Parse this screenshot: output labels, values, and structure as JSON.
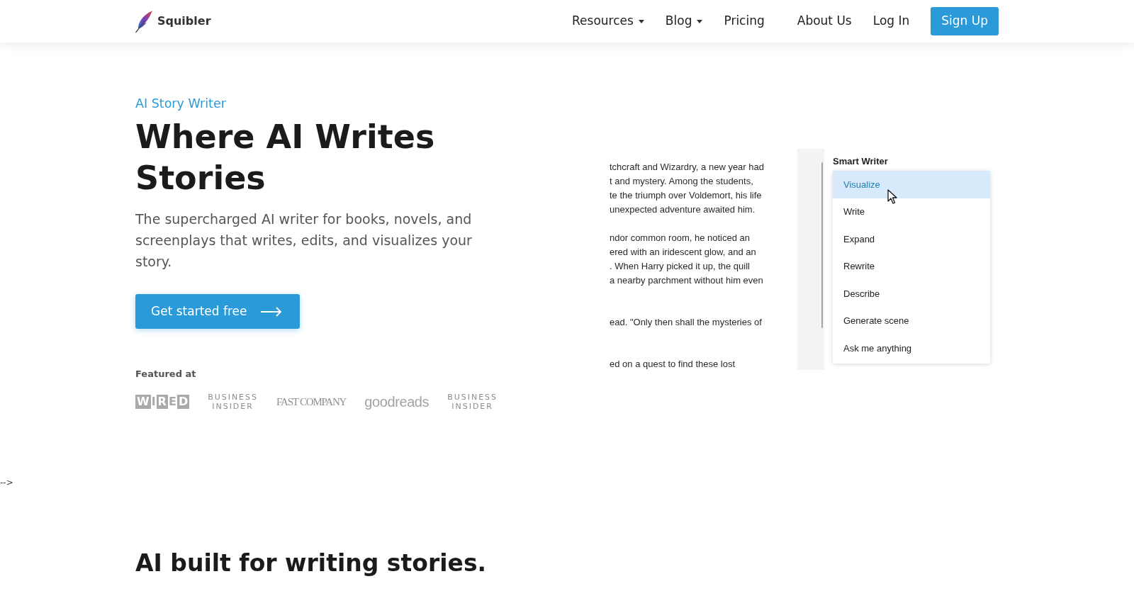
{
  "header": {
    "brand": "Squibler",
    "nav": [
      {
        "label": "Resources",
        "dropdown": true
      },
      {
        "label": "Blog",
        "dropdown": true
      },
      {
        "label": "Pricing",
        "dropdown": false
      },
      {
        "label": "About Us",
        "dropdown": false
      },
      {
        "label": "Log In",
        "dropdown": false
      }
    ],
    "signup_button": "Sign Up"
  },
  "hero": {
    "eyebrow": "AI Story Writer",
    "title": "Where AI Writes Stories",
    "description": "The supercharged AI writer for books, novels, and screenplays that writes, edits, and visualizes your story.",
    "cta": "Get started free",
    "featured": {
      "label": "Featured at",
      "logos": [
        {
          "kind": "wired",
          "text": "WIRED"
        },
        {
          "kind": "business-insider",
          "text": "BUSINESS INSIDER"
        },
        {
          "kind": "fast-company",
          "text": "FAST COMPANY"
        },
        {
          "kind": "goodreads",
          "text": "goodreads"
        },
        {
          "kind": "business-insider",
          "text": "BUSINESS INSIDER"
        }
      ]
    }
  },
  "editor_preview": {
    "story_paragraphs": [
      {
        "lines": [
          "tchcraft and Wizardry, a new year had",
          "t and mystery. Among the students,",
          "te the triumph over Voldemort, his life",
          "unexpected adventure awaited him."
        ]
      },
      {
        "lines": [
          "ndor common room, he noticed an",
          "ered with an iridescent glow, and an",
          ". When Harry picked it up, the quill",
          "a nearby parchment without him even"
        ]
      },
      {
        "lines": [
          "ead. \"Only then shall the mysteries of"
        ]
      },
      {
        "lines": [
          "ed on a quest to find these lost"
        ]
      }
    ],
    "smart_writer": {
      "title": "Smart Writer",
      "items": [
        {
          "label": "Visualize",
          "selected": true
        },
        {
          "label": "Write",
          "selected": false
        },
        {
          "label": "Expand",
          "selected": false
        },
        {
          "label": "Rewrite",
          "selected": false
        },
        {
          "label": "Describe",
          "selected": false
        },
        {
          "label": "Generate scene",
          "selected": false
        },
        {
          "label": "Ask me anything",
          "selected": false
        }
      ]
    }
  },
  "stray_text": "-->",
  "section_title": "AI built for writing stories."
}
